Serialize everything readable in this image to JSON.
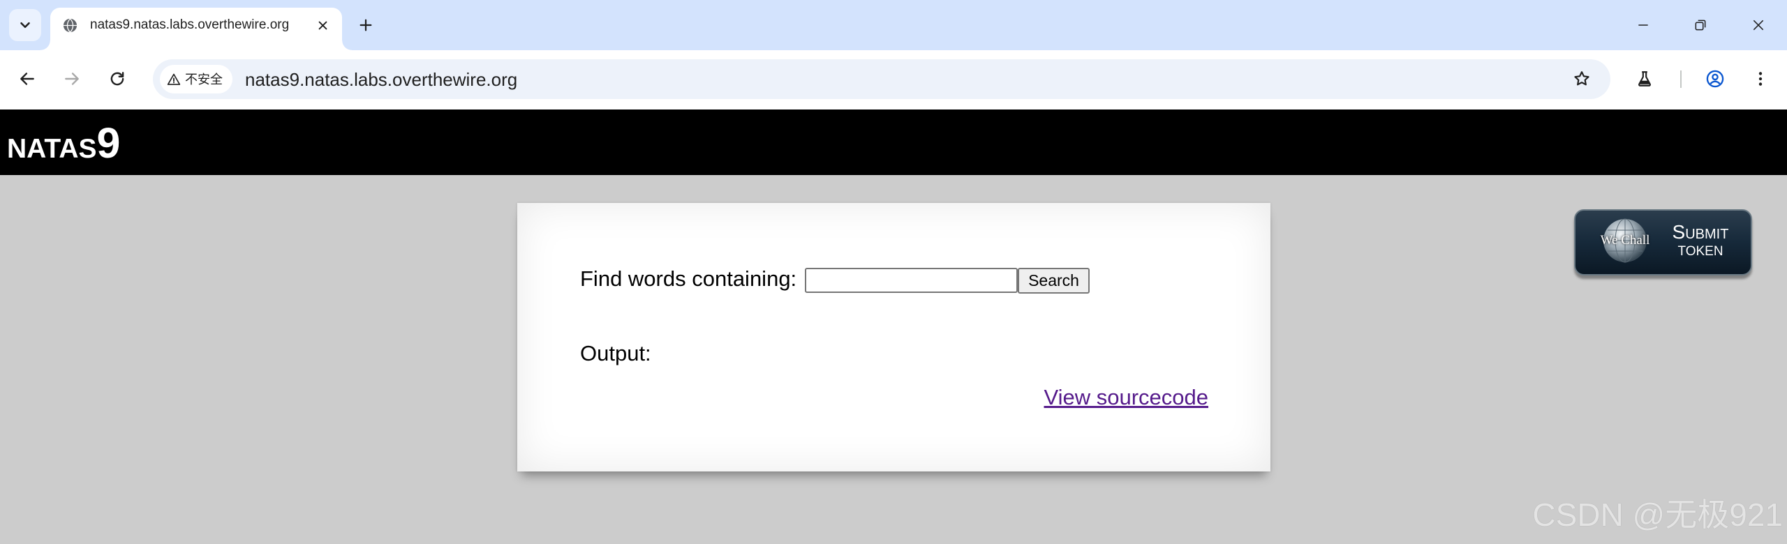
{
  "browser": {
    "tab_list_icon": "chevron-down-icon",
    "tab": {
      "title": "natas9.natas.labs.overthewire.org",
      "favicon": "globe-icon",
      "close_icon": "close-icon"
    },
    "new_tab_icon": "plus-icon",
    "window_controls": [
      "minimize-icon",
      "restore-icon",
      "close-icon"
    ],
    "nav": {
      "back_icon": "arrow-left-icon",
      "forward_icon": "arrow-right-icon",
      "forward_enabled": false,
      "reload_icon": "reload-icon"
    },
    "address_bar": {
      "security_icon": "warning-icon",
      "security_label": "不安全",
      "url": "natas9.natas.labs.overthewire.org",
      "bookmark_icon": "star-icon"
    },
    "toolbar_icons": [
      "flask-icon",
      "profile-icon",
      "more-vert-icon"
    ],
    "colors": {
      "tabstrip": "#d3e3fd",
      "omnibox": "#edf2fa",
      "profile": "#0b57d0"
    }
  },
  "page": {
    "header": {
      "title": "NATAS",
      "level": "9"
    },
    "form": {
      "label": "Find words containing:",
      "input_value": "",
      "submit_label": "Search"
    },
    "output_label": "Output:",
    "source_link": "View sourcecode",
    "wechall_badge": {
      "logo_text": "We Chall",
      "line1": "SUBMIT",
      "line2": "TOKEN"
    },
    "colors": {
      "header_bg": "#000000",
      "page_bg": "#cccccc",
      "link_visited": "#551a8b"
    }
  },
  "watermark": "CSDN @无极921"
}
